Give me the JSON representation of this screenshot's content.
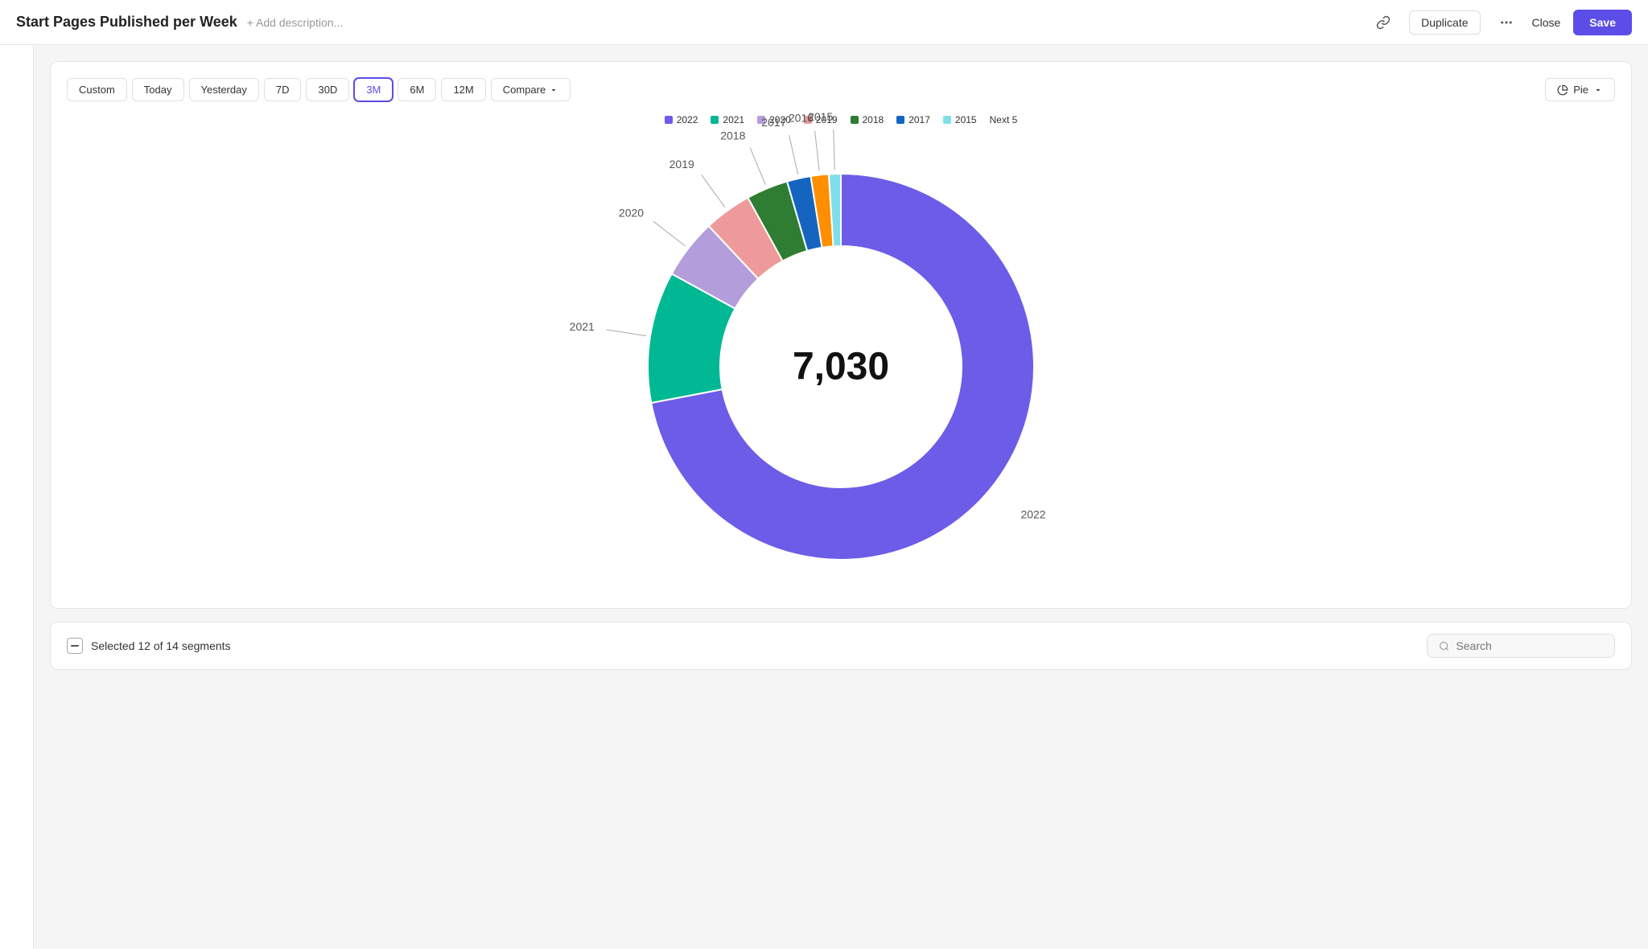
{
  "header": {
    "title": "Start Pages Published per Week",
    "add_description": "+ Add description...",
    "duplicate_label": "Duplicate",
    "close_label": "Close",
    "save_label": "Save"
  },
  "toolbar": {
    "custom_label": "Custom",
    "today_label": "Today",
    "yesterday_label": "Yesterday",
    "7d_label": "7D",
    "30d_label": "30D",
    "3m_label": "3M",
    "6m_label": "6M",
    "12m_label": "12M",
    "compare_label": "Compare",
    "pie_label": "Pie",
    "active": "3M"
  },
  "legend": [
    {
      "year": "2022",
      "color": "#6c5ce7"
    },
    {
      "year": "2021",
      "color": "#00b894"
    },
    {
      "year": "2020",
      "color": "#b39ddb"
    },
    {
      "year": "2019",
      "color": "#ef9a9a"
    },
    {
      "year": "2018",
      "color": "#2e7d32"
    },
    {
      "year": "2017",
      "color": "#1565c0"
    },
    {
      "year": "2015",
      "color": "#80deea"
    }
  ],
  "next5_label": "Next 5",
  "chart": {
    "center_value": "7,030",
    "segments": [
      {
        "year": "2022",
        "color": "#6c5ce7",
        "percentage": 72
      },
      {
        "year": "2021",
        "color": "#00b894",
        "percentage": 11
      },
      {
        "year": "2020",
        "color": "#b39ddb",
        "percentage": 5
      },
      {
        "year": "2019",
        "color": "#ef9a9a",
        "percentage": 4
      },
      {
        "year": "2018",
        "color": "#2e7d32",
        "percentage": 3.5
      },
      {
        "year": "2017",
        "color": "#1565c0",
        "percentage": 2
      },
      {
        "year": "2016",
        "color": "#ff8f00",
        "percentage": 1.5
      },
      {
        "year": "2015",
        "color": "#80deea",
        "percentage": 1
      }
    ]
  },
  "bottom": {
    "selected_text": "Selected 12 of 14 segments",
    "search_placeholder": "Search"
  }
}
